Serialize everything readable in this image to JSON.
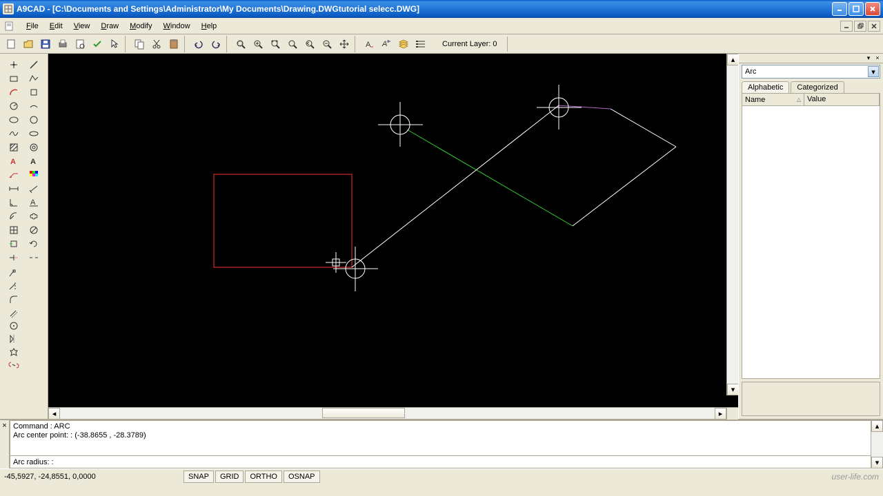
{
  "title": "A9CAD - [C:\\Documents and Settings\\Administrator\\My Documents\\Drawing.DWGtutorial selecc.DWG]",
  "menu": {
    "file": "File",
    "edit": "Edit",
    "view": "View",
    "draw": "Draw",
    "modify": "Modify",
    "window": "Window",
    "help": "Help"
  },
  "toolbar": {
    "layer_label": "Current Layer: 0"
  },
  "properties": {
    "combo_value": "Arc",
    "tab_alpha": "Alphabetic",
    "tab_cat": "Categorized",
    "col_name": "Name",
    "col_value": "Value"
  },
  "command": {
    "history_line1": "Command : ARC",
    "history_line2": "Arc center point: : (-38.8655 , -28.3789)",
    "prompt": "Arc radius: : "
  },
  "status": {
    "coords": "-45,5927, -24,8551, 0,0000",
    "snap": "SNAP",
    "grid": "GRID",
    "ortho": "ORTHO",
    "osnap": "OSNAP",
    "watermark": "user-life.com"
  }
}
